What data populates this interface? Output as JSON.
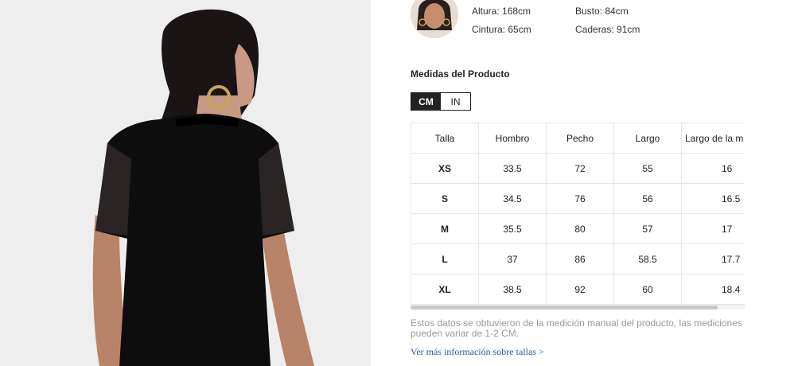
{
  "model": {
    "height": "Altura: 168cm",
    "bust": "Busto: 84cm",
    "waist": "Cintura: 65cm",
    "hips": "Caderas: 91cm"
  },
  "measurements": {
    "title": "Medidas del Producto",
    "units": [
      {
        "label": "CM",
        "active": true
      },
      {
        "label": "IN",
        "active": false
      }
    ],
    "headers": [
      "Talla",
      "Hombro",
      "Pecho",
      "Largo",
      "Largo de la m"
    ],
    "rows": [
      [
        "XS",
        "33.5",
        "72",
        "55",
        "16"
      ],
      [
        "S",
        "34.5",
        "76",
        "56",
        "16.5"
      ],
      [
        "M",
        "35.5",
        "80",
        "57",
        "17"
      ],
      [
        "L",
        "37",
        "86",
        "58.5",
        "17.7"
      ],
      [
        "XL",
        "38.5",
        "92",
        "60",
        "18.4"
      ]
    ],
    "note": "Estos datos se obtuvieron de la medición manual del producto, las mediciones pueden variar de 1-2 CM.",
    "more_link": "Ver más información sobre tallas >"
  },
  "colors": {
    "accent": "#222222",
    "link": "#2a5d97",
    "muted": "#999999"
  }
}
